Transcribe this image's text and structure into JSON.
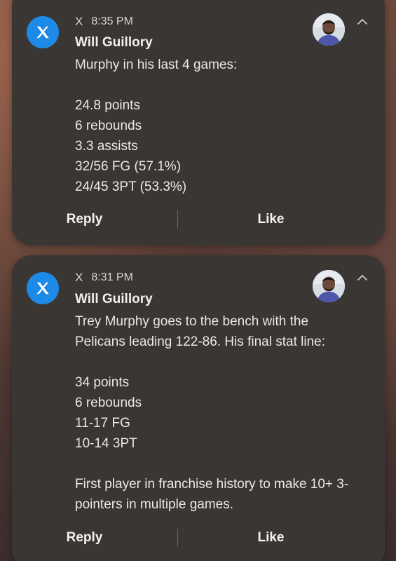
{
  "notifications": [
    {
      "app": "X",
      "time": "8:35 PM",
      "sender": "Will Guillory",
      "body": "Murphy in his last 4 games:\n\n24.8 points\n6 rebounds\n3.3 assists\n32/56 FG (57.1%)\n24/45 3PT (53.3%)",
      "actions": {
        "reply": "Reply",
        "like": "Like"
      }
    },
    {
      "app": "X",
      "time": "8:31 PM",
      "sender": "Will Guillory",
      "body": "Trey Murphy goes to the bench with the Pelicans leading  122-86. His final stat line:\n\n34 points\n6 rebounds\n11-17 FG\n10-14 3PT\n\nFirst player in franchise history to make 10+ 3-pointers in multiple games.",
      "actions": {
        "reply": "Reply",
        "like": "Like"
      }
    }
  ],
  "colors": {
    "app_icon": "#1d8ae8",
    "card": "#3a3634",
    "text": "#ece8e4"
  },
  "icons": {
    "app": "x-logo-icon",
    "avatar": "avatar",
    "expand": "chevron-up-icon"
  }
}
